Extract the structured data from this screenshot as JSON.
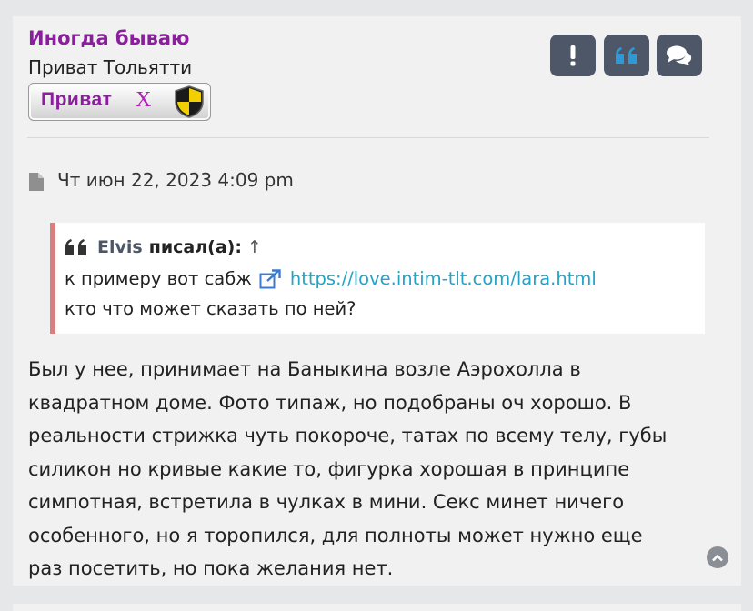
{
  "post": {
    "author": "Иногда бываю",
    "rank": "Приват Тольятти",
    "rank_badge": {
      "text": "Приват",
      "mark": "X"
    },
    "date": "Чт июн 22, 2023 4:09 pm",
    "actions": [
      {
        "name": "report",
        "icon": "exclamation-icon"
      },
      {
        "name": "quote",
        "icon": "quote-icon"
      },
      {
        "name": "reply",
        "icon": "comments-icon"
      }
    ]
  },
  "quote": {
    "author": "Elvis",
    "said": "писал(а):",
    "arrow": "↑",
    "line1_text": "к примеру вот сабж",
    "link": "https://love.intim-tlt.com/lara.html",
    "line2_text": "кто что может сказать по ней?"
  },
  "body": {
    "lines": [
      "Был у нее, принимает на Баныкина возле Аэрохолла в",
      "квадратном доме. Фото типаж, но подобраны оч хорошо. В",
      "реальности стрижка чуть покороче, татах по всему телу, губы",
      "силикон но кривые какие то, фигурка хорошая в принципе",
      "симпотная, встретила в чулках в мини. Секс минет ничего",
      "особенного, но я торопился, для полноты может нужно еще",
      "раз посетить, но пока желания нет."
    ]
  },
  "colors": {
    "author": "#8a1e9c",
    "button": "#4d5767",
    "link": "#23a3c6",
    "quote_border": "#da7f7f"
  }
}
